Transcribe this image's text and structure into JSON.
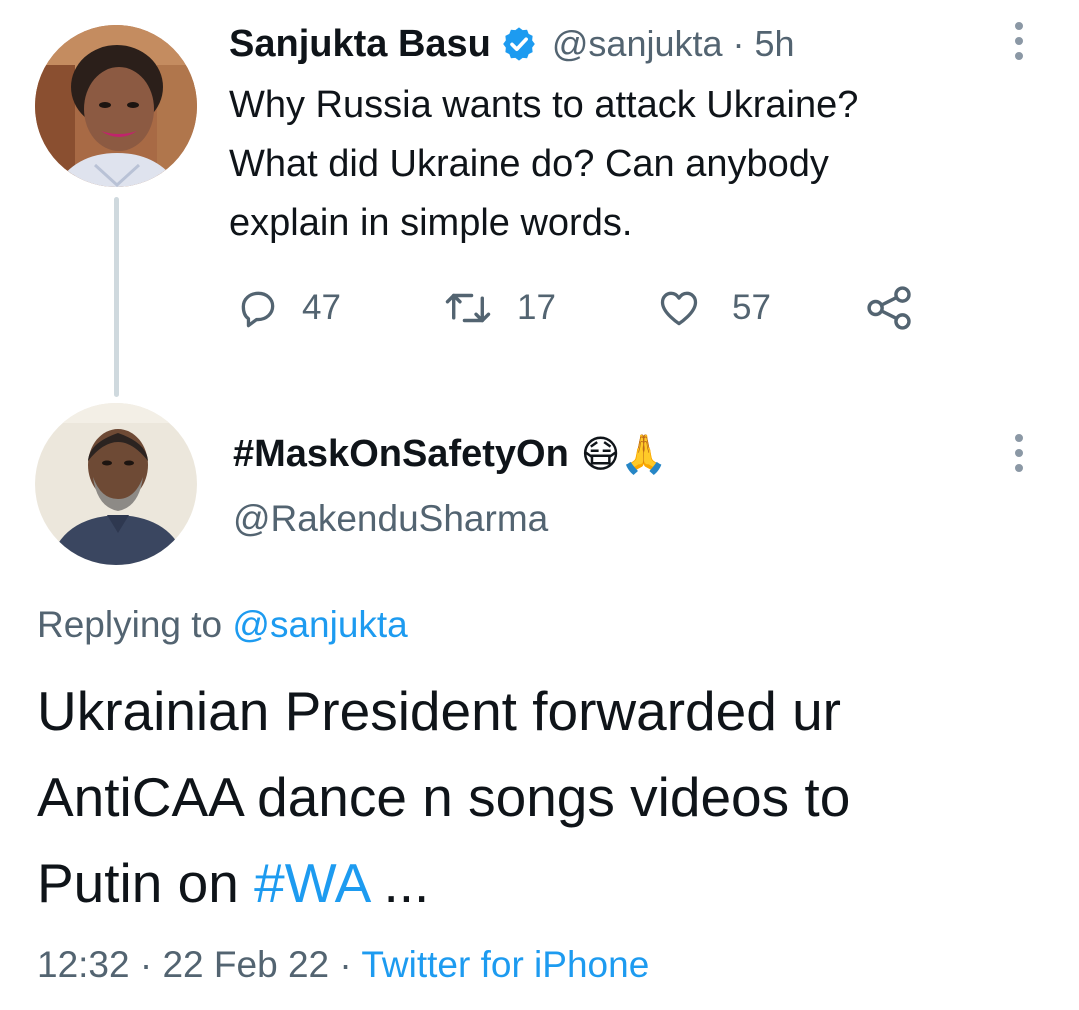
{
  "tweet1": {
    "name": "Sanjukta Basu",
    "handle": "@sanjukta",
    "separator": "·",
    "time": "5h",
    "text_lines": [
      "Why Russia wants to attack Ukraine?",
      "What did Ukraine do? Can anybody",
      "explain in simple words."
    ],
    "replies": "47",
    "retweets": "17",
    "likes": "57"
  },
  "tweet2": {
    "display_name": "#MaskOnSafetyOn",
    "emoji": "😷🙏",
    "handle": "@RakenduSharma",
    "replying_prefix": "Replying to",
    "replying_handle": "@sanjukta",
    "text_lines": [
      "Ukrainian President forwarded ur",
      "AntiCAA dance n songs videos to"
    ],
    "text_line3_prefix": "Putin on",
    "hashtag": "#WA",
    "ellipsis": "...",
    "time": "12:32",
    "date": "22 Feb 22",
    "sep1": "·",
    "sep2": "·",
    "source": "Twitter for iPhone"
  },
  "colors": {
    "accent": "#1d9bf0",
    "muted": "#536471",
    "thread_line": "#cfd9de"
  }
}
